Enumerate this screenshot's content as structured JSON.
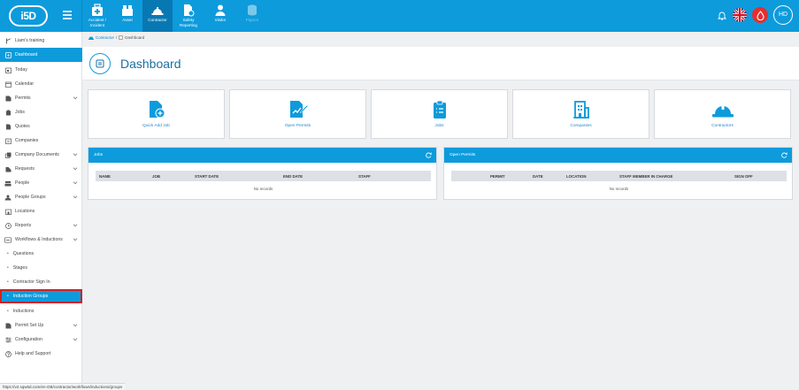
{
  "brand": {
    "logo_text": "i5D"
  },
  "modules": [
    {
      "label": "Accident /\nIncident",
      "icon": "first-aid-kit-icon",
      "state": "normal"
    },
    {
      "label": "Asset",
      "icon": "asset-icon",
      "state": "normal"
    },
    {
      "label": "Contractor",
      "icon": "hard-hat-icon",
      "state": "active"
    },
    {
      "label": "Safety\nReporting",
      "icon": "safety-report-icon",
      "state": "normal"
    },
    {
      "label": "Visitor",
      "icon": "visitor-icon",
      "state": "normal"
    },
    {
      "label": "Pigeon",
      "icon": "pigeon-icon",
      "state": "disabled"
    }
  ],
  "user": {
    "initials": "HD"
  },
  "sidebar": {
    "tenant": "Liam's training",
    "items": [
      {
        "label": "Dashboard",
        "icon": "dashboard-icon",
        "active": true
      },
      {
        "label": "Today",
        "icon": "today-icon"
      },
      {
        "label": "Calendar",
        "icon": "calendar-icon"
      },
      {
        "label": "Permits",
        "icon": "permits-icon",
        "expandable": true
      },
      {
        "label": "Jobs",
        "icon": "jobs-icon"
      },
      {
        "label": "Quotes",
        "icon": "quotes-icon"
      },
      {
        "label": "Companies",
        "icon": "companies-icon"
      },
      {
        "label": "Company Documents",
        "icon": "documents-icon",
        "expandable": true
      },
      {
        "label": "Requests",
        "icon": "requests-icon",
        "expandable": true
      },
      {
        "label": "People",
        "icon": "people-icon",
        "expandable": true
      },
      {
        "label": "People Groups",
        "icon": "people-groups-icon",
        "expandable": true
      },
      {
        "label": "Locations",
        "icon": "locations-icon"
      },
      {
        "label": "Reports",
        "icon": "reports-icon",
        "expandable": true
      },
      {
        "label": "Workflows & Inductions",
        "icon": "workflows-icon",
        "expandable": true
      },
      {
        "label": "Questions",
        "sub": true
      },
      {
        "label": "Stages",
        "sub": true
      },
      {
        "label": "Contractor Sign In",
        "sub": true
      },
      {
        "label": "Induction Groups",
        "sub": true,
        "selected": true
      },
      {
        "label": "Inductions",
        "sub": true
      },
      {
        "label": "Permit Set Up",
        "icon": "permit-setup-icon",
        "expandable": true
      },
      {
        "label": "Configuration",
        "icon": "configuration-icon",
        "expandable": true
      },
      {
        "label": "Help and Support",
        "icon": "help-icon"
      }
    ]
  },
  "breadcrumb": {
    "root": "Contractor",
    "separator": "/",
    "current": "Dashboard"
  },
  "page": {
    "title": "Dashboard"
  },
  "tiles": [
    {
      "label": "Quick Add Job",
      "icon": "add-job-icon"
    },
    {
      "label": "Open Permits",
      "icon": "open-permits-icon"
    },
    {
      "label": "Jobs",
      "icon": "jobs-clipboard-icon"
    },
    {
      "label": "Companies",
      "icon": "building-icon"
    },
    {
      "label": "Contractors",
      "icon": "hard-hat-icon"
    }
  ],
  "jobs_panel": {
    "title": "Jobs",
    "columns": [
      "NAME",
      "JOB",
      "START DATE",
      "END DATE",
      "STAFF"
    ],
    "empty_text": "No records"
  },
  "permits_panel": {
    "title": "Open Permits",
    "columns": [
      "PERMIT",
      "DATE",
      "LOCATION",
      "STAFF MEMBER IN CHARGE",
      "SIGN OFF"
    ],
    "empty_text": "No records"
  },
  "status_url": "https://v2.sqw5d.com/en-GB/contractor/workflows/inductions/groups",
  "colors": {
    "primary": "#0d9bdc",
    "active_module": "#0878b3",
    "selection_outline": "#d42020"
  }
}
